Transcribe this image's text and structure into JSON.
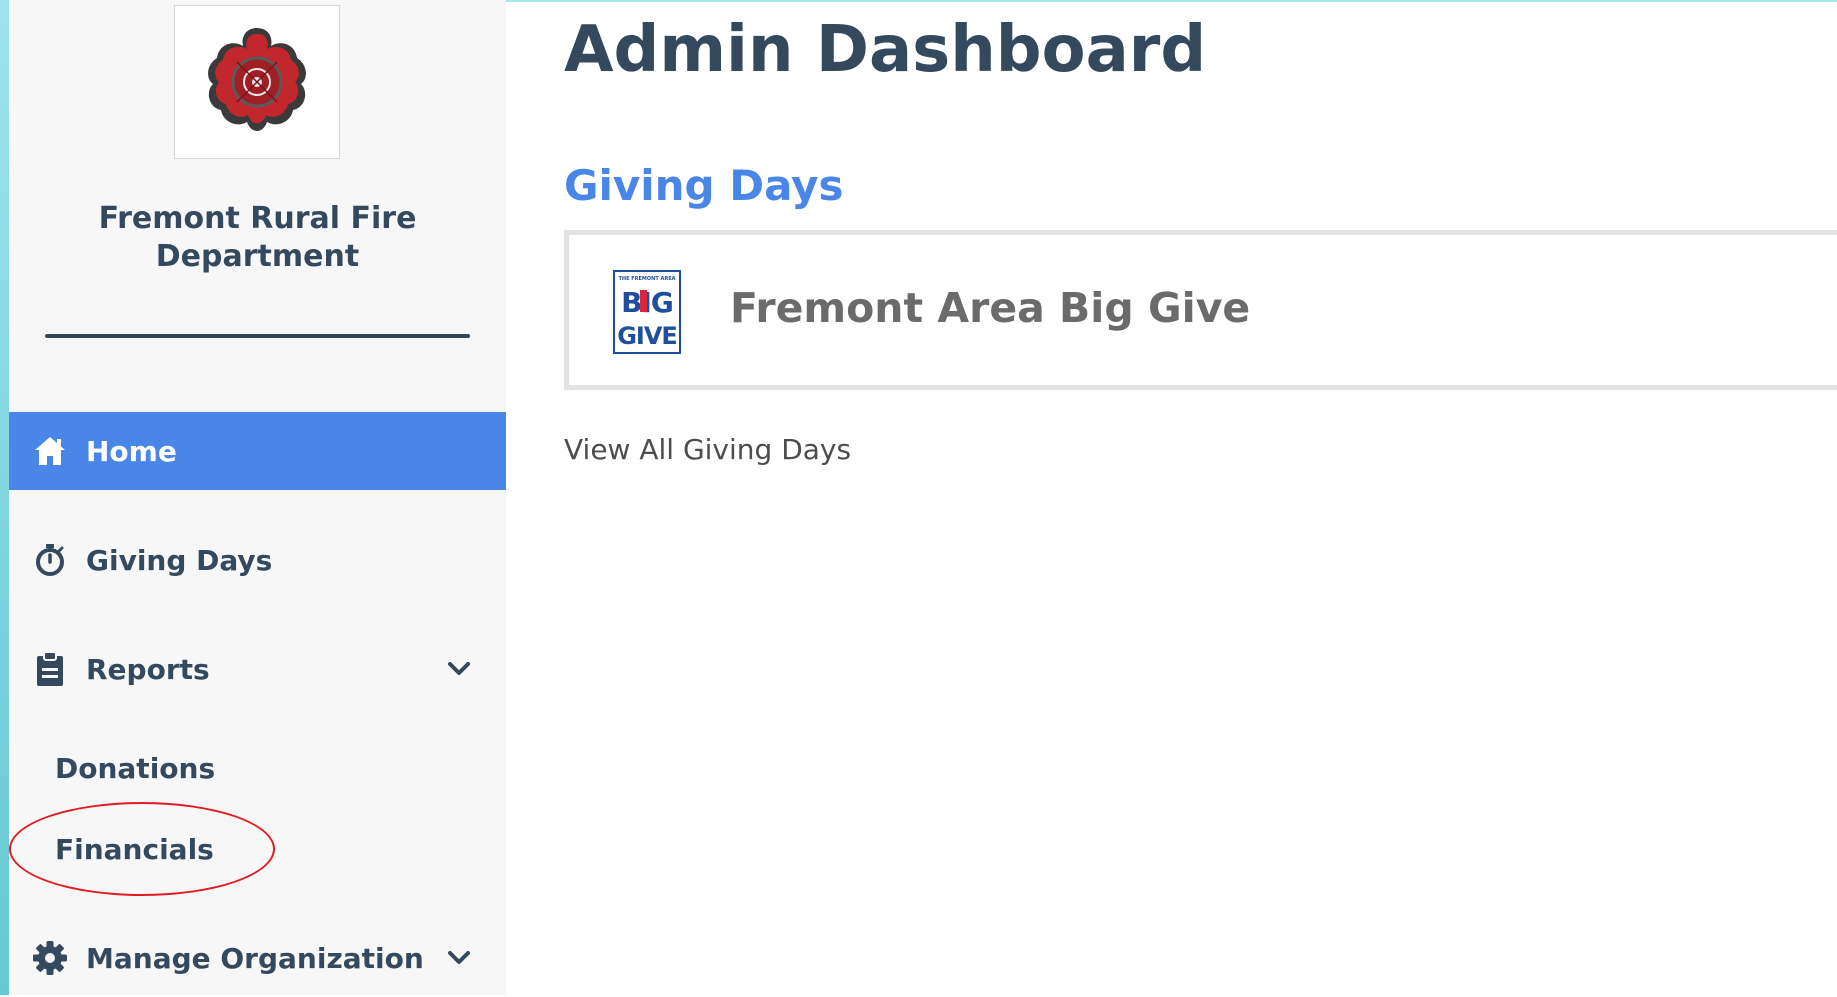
{
  "sidebar": {
    "org_name_line1": "Fremont Rural Fire",
    "org_name_line2": "Department",
    "logo_icon": "fire-department-maltese-cross-logo",
    "nav": {
      "home": {
        "label": "Home",
        "icon": "home-icon",
        "active": true
      },
      "giving_days": {
        "label": "Giving Days",
        "icon": "stopwatch-icon"
      },
      "reports": {
        "label": "Reports",
        "icon": "clipboard-icon",
        "expanded": true,
        "sub_items": {
          "donations": "Donations",
          "financials": "Financials"
        }
      },
      "manage_org": {
        "label": "Manage Organization",
        "icon": "gear-icon"
      }
    }
  },
  "main": {
    "title": "Admin Dashboard",
    "giving_days": {
      "section_title": "Giving Days",
      "card": {
        "title": "Fremont Area Big Give",
        "logo_top_text": "THE FREMONT AREA",
        "logo_line1": "BIG",
        "logo_line2": "GIVE"
      },
      "view_all_label": "View All Giving Days"
    }
  },
  "colors": {
    "accent_blue": "#4a86e8",
    "dark_text": "#34495e",
    "annotation_red": "#e01b24",
    "sidebar_bg": "#f7f7f7"
  }
}
